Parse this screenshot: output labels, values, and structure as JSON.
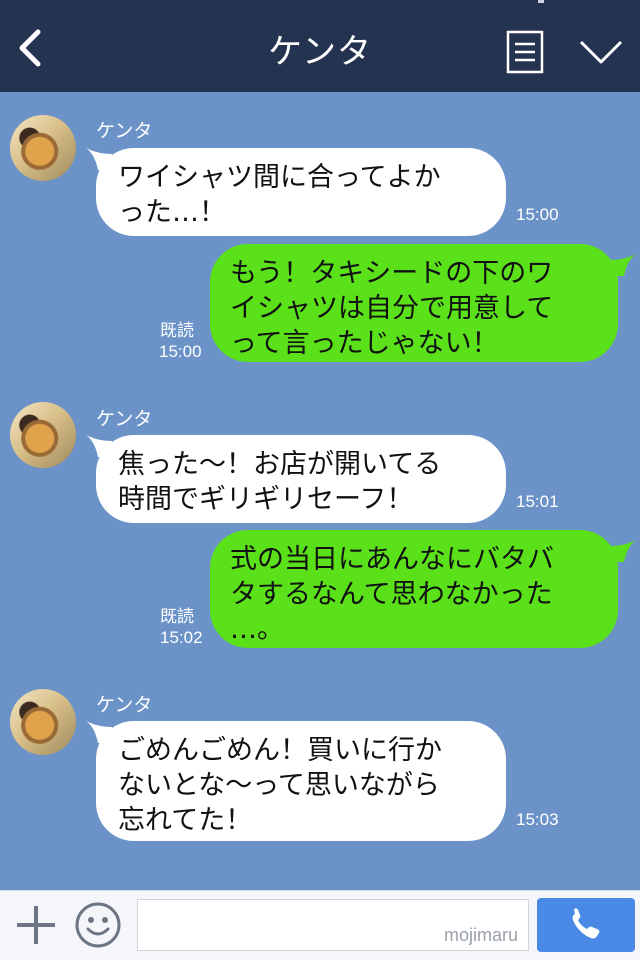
{
  "header": {
    "title": "ケンタ",
    "back_icon": "chevron-left-icon",
    "notes_icon": "notes-icon",
    "menu_icon": "chevron-down-icon"
  },
  "messages": [
    {
      "sender": "ケンタ",
      "text": "ワイシャツ間に合ってよかった…！",
      "lines": [
        "ワイシャツ間に合ってよか",
        "った…！"
      ],
      "time": "15:00",
      "direction": "in"
    },
    {
      "text": "もう！タキシードの下のワイシャツは自分で用意してって言ったじゃない！",
      "lines": [
        "もう！タキシードの下のワ",
        "イシャツは自分で用意して",
        "って言ったじゃない！"
      ],
      "time": "15:00",
      "read": "既読",
      "direction": "out"
    },
    {
      "sender": "ケンタ",
      "text": "焦った〜！お店が開いてる時間でギリギリセーフ！",
      "lines": [
        "焦った〜！お店が開いてる",
        "時間でギリギリセーフ！"
      ],
      "time": "15:01",
      "direction": "in"
    },
    {
      "text": "式の当日にあんなにバタバタするなんて思わなかった…。",
      "lines": [
        "式の当日にあんなにバタバ",
        "タするなんて思わなかった",
        "…。"
      ],
      "time": "15:02",
      "read": "既読",
      "direction": "out"
    },
    {
      "sender": "ケンタ",
      "text": "ごめんごめん！買いに行かないとな〜って思いながら忘れてた！",
      "lines": [
        "ごめんごめん！買いに行か",
        "ないとな〜って思いながら",
        "忘れてた！"
      ],
      "time": "15:03",
      "direction": "in"
    }
  ],
  "footer": {
    "input_placeholder": "",
    "watermark": "mojimaru",
    "plus_icon": "plus-icon",
    "emoji_icon": "smiley-icon",
    "call_icon": "phone-icon"
  },
  "colors": {
    "header_bg": "#243350",
    "chat_bg": "#6b93c8",
    "incoming_bubble": "#ffffff",
    "outgoing_bubble": "#5be119",
    "call_button": "#4a8ae6"
  }
}
